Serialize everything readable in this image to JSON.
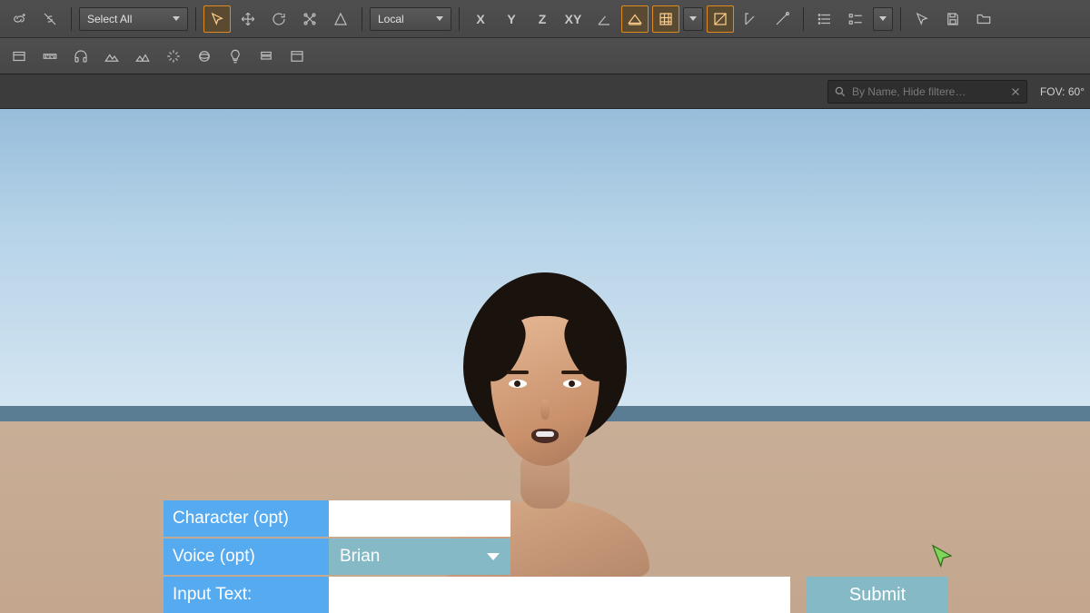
{
  "toolbar": {
    "select_dropdown": "Select All",
    "space_dropdown": "Local",
    "axis": {
      "x": "X",
      "y": "Y",
      "z": "Z",
      "xy": "XY"
    }
  },
  "search": {
    "placeholder": "By Name, Hide filtere…"
  },
  "fov_label": "FOV: 60°",
  "panel": {
    "character_label": "Character (opt)",
    "character_value": "",
    "voice_label": "Voice (opt)",
    "voice_value": "Brian",
    "input_label": "Input Text:",
    "input_value": "",
    "submit_label": "Submit"
  }
}
